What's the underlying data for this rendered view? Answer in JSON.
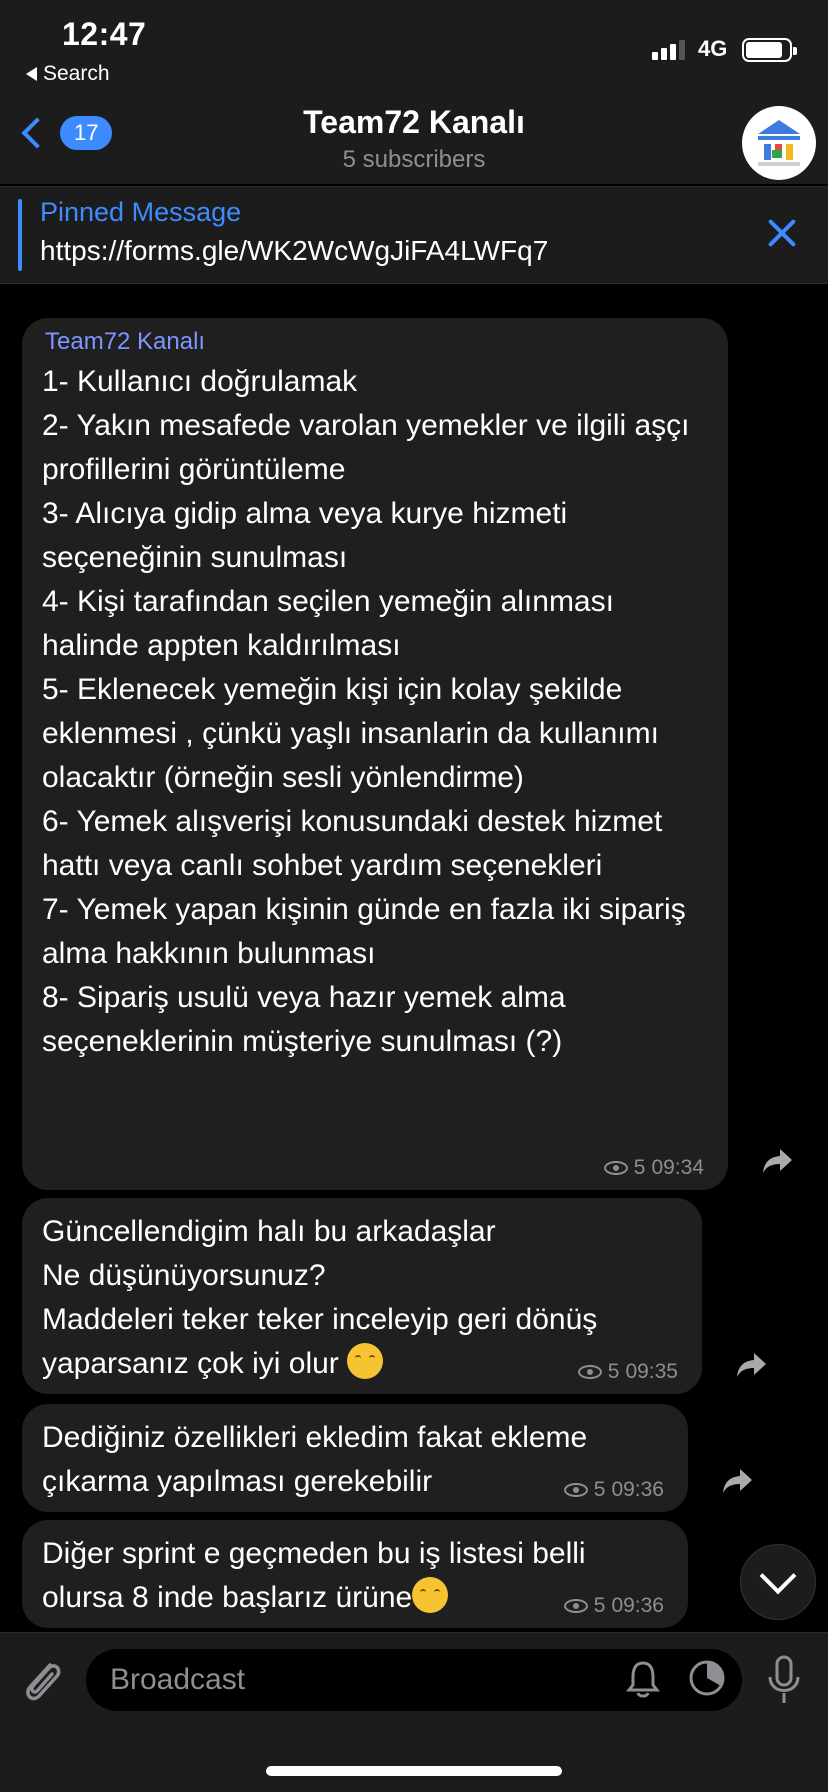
{
  "status_bar": {
    "time": "12:47",
    "back_label": "Search",
    "network": "4G"
  },
  "nav": {
    "back_badge": "17",
    "title": "Team72 Kanalı",
    "subtitle": "5 subscribers"
  },
  "pinned": {
    "title": "Pinned Message",
    "text": "https://forms.gle/WK2WcWgJiFA4LWFq7"
  },
  "messages": [
    {
      "sender": "Team72 Kanalı",
      "text": "1- Kullanıcı doğrulamak\n2- Yakın mesafede varolan yemekler ve ilgili aşçı profillerini görüntüleme\n3- Alıcıya gidip alma veya kurye hizmeti seçeneğinin sunulması\n4- Kişi tarafından seçilen yemeğin alınması halinde appten kaldırılması\n5- Eklenecek yemeğin kişi için kolay şekilde eklenmesi , çünkü yaşlı insanlarin da kullanımı olacaktır (örneğin sesli yönlendirme)\n6- Yemek alışverişi konusundaki destek hizmet hattı veya canlı sohbet yardım seçenekleri\n7- Yemek yapan kişinin günde en fazla iki sipariş alma hakkının bulunması\n8- Sipariş usulü veya hazır yemek alma seçeneklerinin müşteriye sunulması (?)",
      "views": "5",
      "time": "09:34"
    },
    {
      "text": "Güncellendigim halı bu arkadaşlar\nNe düşünüyorsunuz?\nMaddeleri teker teker inceleyip geri dönüş yaparsanız çok iyi olur",
      "views": "5",
      "time": "09:35"
    },
    {
      "text": "Dediğiniz özellikleri ekledim fakat ekleme çıkarma yapılması gerekebilir",
      "views": "5",
      "time": "09:36"
    },
    {
      "text": "Diğer sprint e geçmeden bu iş listesi belli olursa 8 inde başlarız ürüne",
      "views": "5",
      "time": "09:36"
    }
  ],
  "composer": {
    "placeholder": "Broadcast"
  },
  "colors": {
    "accent": "#3e8bff",
    "bubble": "#1f1f20",
    "bar": "#1c1c1d"
  }
}
